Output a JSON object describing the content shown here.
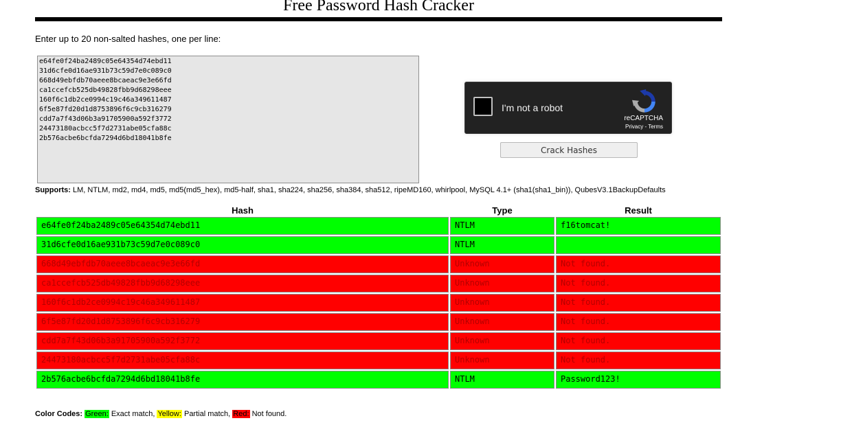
{
  "page": {
    "title": "Free Password Hash Cracker",
    "instructions": "Enter up to 20 non-salted hashes, one per line:"
  },
  "hash_input": {
    "value": "e64fe0f24ba2489c05e64354d74ebd11\n31d6cfe0d16ae931b73c59d7e0c089c0\n668d49ebfdb70aeee8bcaeac9e3e66fd\nca1ccefcb525db49828fbb9d68298eee\n160f6c1db2ce0994c19c46a349611487\n6f5e87fd20d1d8753896f6c9cb316279\ncdd7a7f43d06b3a91705900a592f3772\n24473180acbcc5f7d2731abe05cfa88c\n2b576acbe6bcfda7294d6bd18041b8fe"
  },
  "recaptcha": {
    "label": "I'm not a robot",
    "brand": "reCAPTCHA",
    "privacy": "Privacy",
    "separator": " - ",
    "terms": "Terms"
  },
  "crack_button": {
    "label": "Crack Hashes"
  },
  "supports": {
    "label": "Supports:",
    "text": " LM, NTLM, md2, md4, md5, md5(md5_hex), md5-half, sha1, sha224, sha256, sha384, sha512, ripeMD160, whirlpool, MySQL 4.1+ (sha1(sha1_bin)), QubesV3.1BackupDefaults"
  },
  "table": {
    "headers": {
      "hash": "Hash",
      "type": "Type",
      "result": "Result"
    },
    "rows": [
      {
        "hash": "e64fe0f24ba2489c05e64354d74ebd11",
        "type": "NTLM",
        "result": "f16tomcat!",
        "status": "green"
      },
      {
        "hash": "31d6cfe0d16ae931b73c59d7e0c089c0",
        "type": "NTLM",
        "result": "",
        "status": "green"
      },
      {
        "hash": "668d49ebfdb70aeee8bcaeac9e3e66fd",
        "type": "Unknown",
        "result": "Not found.",
        "status": "red"
      },
      {
        "hash": "ca1ccefcb525db49828fbb9d68298eee",
        "type": "Unknown",
        "result": "Not found.",
        "status": "red"
      },
      {
        "hash": "160f6c1db2ce0994c19c46a349611487",
        "type": "Unknown",
        "result": "Not found.",
        "status": "red"
      },
      {
        "hash": "6f5e87fd20d1d8753896f6c9cb316279",
        "type": "Unknown",
        "result": "Not found.",
        "status": "red"
      },
      {
        "hash": "cdd7a7f43d06b3a91705900a592f3772",
        "type": "Unknown",
        "result": "Not found.",
        "status": "red"
      },
      {
        "hash": "24473180acbcc5f7d2731abe05cfa88c",
        "type": "Unknown",
        "result": "Not found.",
        "status": "red"
      },
      {
        "hash": "2b576acbe6bcfda7294d6bd18041b8fe",
        "type": "NTLM",
        "result": "Password123!",
        "status": "green"
      }
    ]
  },
  "legend": {
    "label": "Color Codes:",
    "items": [
      {
        "swatch": "Green:",
        "text": " Exact match, ",
        "color": "#00ff00",
        "text_color": "#000000"
      },
      {
        "swatch": "Yellow:",
        "text": " Partial match, ",
        "color": "#ffff00",
        "text_color": "#000000"
      },
      {
        "swatch": "Red:",
        "text": " Not found.",
        "color": "#ff0000",
        "text_color": "#000000"
      }
    ]
  },
  "colors": {
    "green": "#00ff00",
    "yellow": "#ffff00",
    "red": "#ff0000",
    "red_text": "#b30000",
    "green_text": "#000000",
    "recaptcha_bg": "#222222",
    "recaptcha_logo_blue": "#1c3aa9",
    "recaptcha_logo_light": "#4285f4",
    "recaptcha_logo_grey": "#ababab"
  }
}
